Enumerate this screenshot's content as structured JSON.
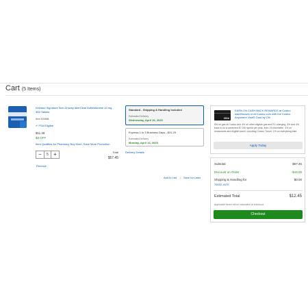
{
  "cart": {
    "title": "Cart",
    "count_label": "(5 Items)"
  },
  "item": {
    "name": "Kirkland Signature Non-Drowsy AllerClear Antihistamine 10 mg., 365 Tablets",
    "item_number": "Item 529888",
    "fsa": "FSA Eligible",
    "price": "$11.49",
    "discount": "$3 OFF",
    "qualifies": "Item Qualifies for Pharmacy Buy More, Save More Promotion",
    "quantity": "5",
    "total_label": "Total",
    "total_value": "$57.45",
    "remove": "Remove"
  },
  "shipping": {
    "option1": {
      "title": "Standard - Shipping & Handling Included",
      "est_label": "Estimated Delivery",
      "date": "Wednesday, April 16, 2025"
    },
    "option2": {
      "title": "Express 1 to 3 Business Days - $31.29",
      "est_label": "Estimated Delivery",
      "date": "Monday, April 14, 2025"
    },
    "details_link": "Delivery Details"
  },
  "actions": {
    "add_to_list": "Add to List",
    "separator": "|",
    "save_for_later": "Save for Later"
  },
  "promo": {
    "card_brand": "VISA",
    "headline": "EARN 2% CASH BACK REWARDS at Costco warehouses or at Costco.com with the Costco Anywhere Visa® Card by Citi",
    "body": "5% on gas at Costco and 4% on other eligible gas and EV charging, 3% and 4% back is on a combined $7,000 spend per year, then 1% thereafter. 3% on restaurants and eligible travel, including Costco Travel. 1% on everything else.",
    "button": "Apply Today"
  },
  "summary": {
    "subtotal_label": "Subtotal",
    "subtotal_value": "$57.45",
    "discount_label": "Discount on Order",
    "discount_value": "-$15.00",
    "shipping_label": "Shipping & Handling for",
    "zip": "75032-4470",
    "shipping_value": "$0.00",
    "estimated_label": "Estimated Total",
    "estimated_value": "$12.45",
    "tax_note": "Applicable taxes will be calculated at checkout.",
    "checkout": "Checkout"
  },
  "colors": {
    "link": "#0a5fb4",
    "green": "#2b8a2b",
    "checkout": "#1e8a1e"
  }
}
